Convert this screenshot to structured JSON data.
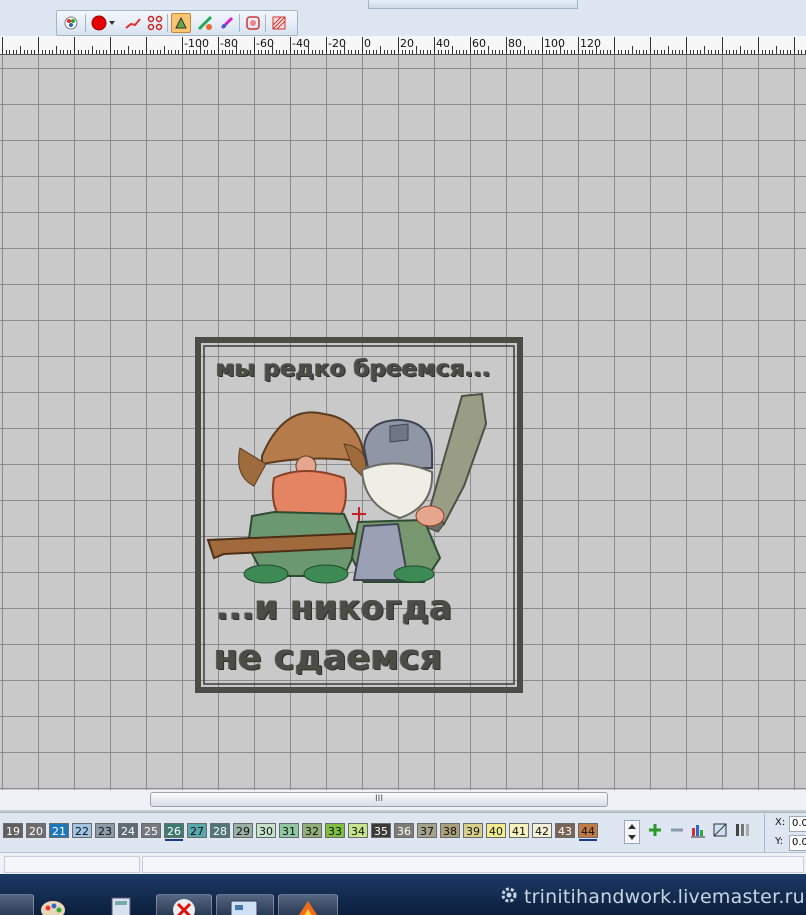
{
  "ruler": {
    "labels": [
      "-100",
      "-80",
      "-60",
      "-40",
      "-20",
      "0",
      "20",
      "40",
      "60",
      "80",
      "100",
      "120"
    ]
  },
  "design": {
    "line1": "мы  редко бреемся...",
    "line2": "...и никогда",
    "line3": "не сдаемся"
  },
  "scroll": {
    "grip": "III"
  },
  "palette": {
    "swatches": [
      {
        "n": "19",
        "c": "#5f5f5f",
        "t": "#ffffff"
      },
      {
        "n": "20",
        "c": "#6e6e6e",
        "t": "#ffffff"
      },
      {
        "n": "21",
        "c": "#1f76b8",
        "t": "#ffffff"
      },
      {
        "n": "22",
        "c": "#9fc4e4",
        "t": "#111111"
      },
      {
        "n": "23",
        "c": "#8c9aa8",
        "t": "#111111"
      },
      {
        "n": "24",
        "c": "#5e6c78",
        "t": "#ffffff"
      },
      {
        "n": "25",
        "c": "#767a80",
        "t": "#ffffff"
      },
      {
        "n": "26",
        "c": "#3e7a6f",
        "t": "#ffffff",
        "sel": true
      },
      {
        "n": "27",
        "c": "#57a7ad",
        "t": "#111111"
      },
      {
        "n": "28",
        "c": "#50787a",
        "t": "#ffffff"
      },
      {
        "n": "29",
        "c": "#9ab0a4",
        "t": "#111111"
      },
      {
        "n": "30",
        "c": "#c8e2cc",
        "t": "#111111"
      },
      {
        "n": "31",
        "c": "#8fc79f",
        "t": "#111111"
      },
      {
        "n": "32",
        "c": "#8fae7a",
        "t": "#111111"
      },
      {
        "n": "33",
        "c": "#7fbe3f",
        "t": "#111111"
      },
      {
        "n": "34",
        "c": "#c6e58e",
        "t": "#111111"
      },
      {
        "n": "35",
        "c": "#3a3a38",
        "t": "#ffffff"
      },
      {
        "n": "36",
        "c": "#7d7d78",
        "t": "#ffffff"
      },
      {
        "n": "37",
        "c": "#a5a28c",
        "t": "#111111"
      },
      {
        "n": "38",
        "c": "#a9a07a",
        "t": "#111111"
      },
      {
        "n": "39",
        "c": "#d8d08a",
        "t": "#111111"
      },
      {
        "n": "40",
        "c": "#f3ec8c",
        "t": "#111111"
      },
      {
        "n": "41",
        "c": "#f7f2bd",
        "t": "#111111"
      },
      {
        "n": "42",
        "c": "#f5f1d8",
        "t": "#111111"
      },
      {
        "n": "43",
        "c": "#7a6455",
        "t": "#ffffff"
      },
      {
        "n": "44",
        "c": "#c27a45",
        "t": "#111111",
        "sel": true
      }
    ]
  },
  "coords": {
    "x_label": "X:",
    "y_label": "Y:",
    "x_value": "0.0",
    "y_value": "0.0"
  },
  "watermark": "trinitihandwork.livemaster.ru",
  "colors": {
    "grid_bg": "#c9c9c9",
    "grid_line": "#8c8c8c",
    "thread_dark": "#4a4c45",
    "toolbar_active": "#f6c571"
  }
}
